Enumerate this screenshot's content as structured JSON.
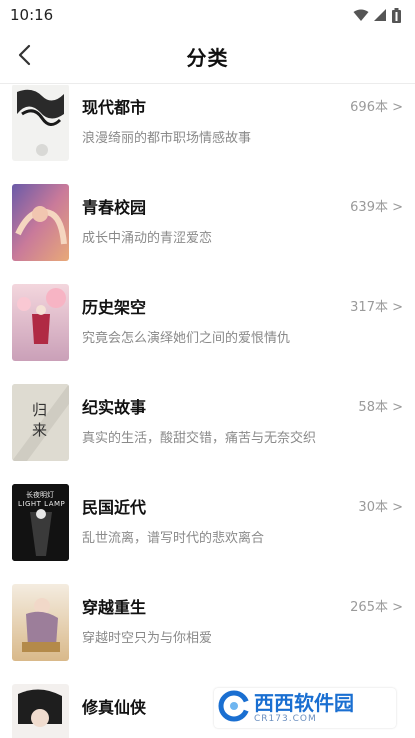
{
  "status_bar": {
    "time": "10:16"
  },
  "header": {
    "title": "分类"
  },
  "categories": [
    {
      "title": "现代都市",
      "desc": "浪漫绮丽的都市职场情感故事",
      "count": "696本 >"
    },
    {
      "title": "青春校园",
      "desc": "成长中涌动的青涩爱恋",
      "count": "639本 >"
    },
    {
      "title": "历史架空",
      "desc": "究竟会怎么演绎她们之间的爱恨情仇",
      "count": "317本 >"
    },
    {
      "title": "纪实故事",
      "desc": "真实的生活，酸甜交错，痛苦与无奈交织",
      "count": "58本 >"
    },
    {
      "title": "民国近代",
      "desc": "乱世流离，谱写时代的悲欢离合",
      "count": "30本 >"
    },
    {
      "title": "穿越重生",
      "desc": "穿越时空只为与你相爱",
      "count": "265本 >"
    },
    {
      "title": "修真仙侠",
      "desc": "",
      "count": ""
    }
  ],
  "covers": {
    "c4_text": "归来",
    "c5_text1": "长夜明灯",
    "c5_text2": "LIGHT LAMP"
  },
  "watermark": {
    "main": "西西软件园",
    "sub": "CR173.COM"
  }
}
